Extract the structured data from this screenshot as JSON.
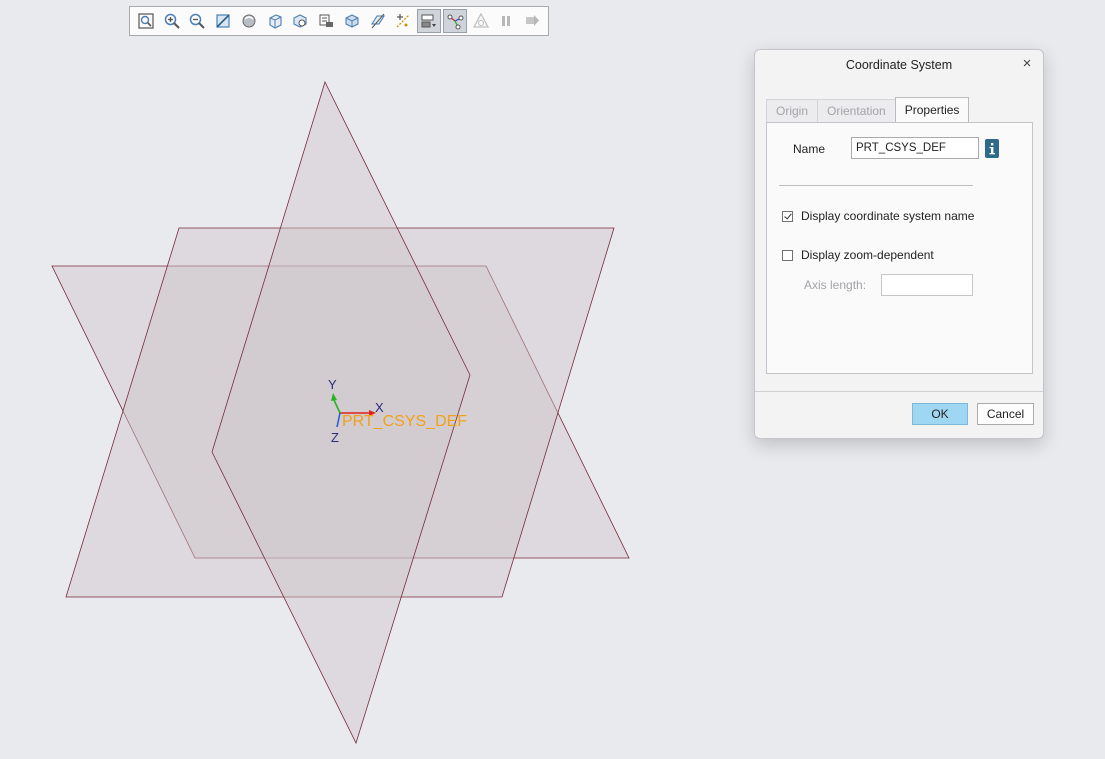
{
  "toolbar": {
    "icons": [
      "refit-icon",
      "zoom-in-icon",
      "zoom-out-icon",
      "repaint-icon",
      "display-style-icon",
      "saved-orientations-icon",
      "view-manager-icon",
      "appearance-icon",
      "perspective-icon",
      "section-icon",
      "datum-display-icon",
      "annotation-display-icon",
      "spin-center-icon",
      "simulation-icon",
      "pause-icon",
      "next-icon"
    ]
  },
  "viewport": {
    "csys_label": "PRT_CSYS_DEF",
    "axis_x": "X",
    "axis_y": "Y",
    "axis_z": "Z",
    "colors": {
      "plane_fill": "#cfc6ca",
      "plane_edge": "#7a2a3a",
      "csys_label": "#f0a21a",
      "x_axis": "#e0231d",
      "y_axis": "#2ab31f",
      "z_axis": "#2c5fd6"
    }
  },
  "dialog": {
    "title": "Coordinate System",
    "close_symbol": "×",
    "tabs": [
      {
        "label": "Origin",
        "active": false
      },
      {
        "label": "Orientation",
        "active": false
      },
      {
        "label": "Properties",
        "active": true
      }
    ],
    "name_label": "Name",
    "name_value": "PRT_CSYS_DEF",
    "display_name_label": "Display coordinate system name",
    "display_name_checked": true,
    "zoom_dependent_label": "Display zoom-dependent",
    "zoom_dependent_checked": false,
    "axis_length_label": "Axis length:",
    "axis_length_value": "",
    "ok_label": "OK",
    "cancel_label": "Cancel",
    "colors": {
      "ok_button": "#9fd7f2",
      "info_button": "#2d6b88"
    }
  }
}
